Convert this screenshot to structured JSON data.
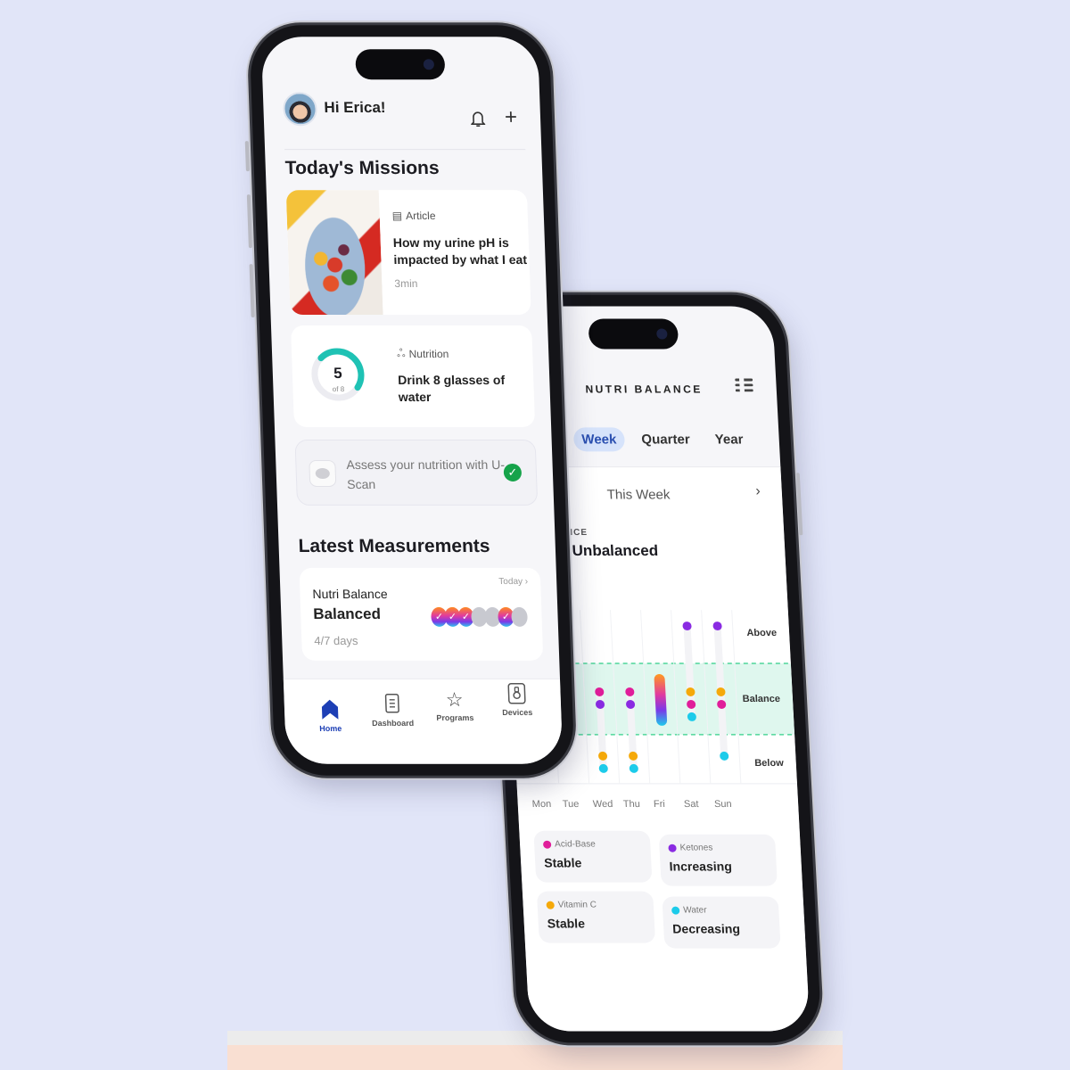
{
  "colors": {
    "background": "#e1e5f8",
    "accent_blue": "#1d3fb5",
    "gauge_teal": "#1fc2b4",
    "success_green": "#16a34a",
    "balance_band": "#dff7ee",
    "acid_base": "#e01e9a",
    "ketones": "#8a2be2",
    "vitamin_c": "#f5a90a",
    "water": "#1ccbea"
  },
  "home_screen": {
    "greeting": "Hi Erica!",
    "header_icons": [
      "bell-icon",
      "plus-icon"
    ],
    "missions_title": "Today's Missions",
    "article_card": {
      "tag": "Article",
      "title": "How my urine pH is impacted by what I eat",
      "duration": "3min"
    },
    "nutrition_card": {
      "tag": "Nutrition",
      "title": "Drink 8 glasses of water",
      "progress_value": "5",
      "progress_total_label": "of 8",
      "progress_current": 5,
      "progress_total": 8
    },
    "uscan_card": {
      "text": "Assess your nutrition with U-Scan",
      "completed": true
    },
    "measurements_title": "Latest Measurements",
    "measurement_card": {
      "name": "Nutri Balance",
      "status": "Balanced",
      "days": "4/7 days",
      "date_link": "Today",
      "week_results": [
        true,
        true,
        true,
        false,
        false,
        true,
        false
      ]
    },
    "tabbar": [
      {
        "label": "Home",
        "icon": "home-icon",
        "active": true
      },
      {
        "label": "Dashboard",
        "icon": "dashboard-icon",
        "active": false
      },
      {
        "label": "Programs",
        "icon": "star-icon",
        "active": false
      },
      {
        "label": "Devices",
        "icon": "device-icon",
        "active": false
      }
    ]
  },
  "balance_screen": {
    "title": "NUTRI BALANCE",
    "period_tabs": [
      {
        "label": "Week",
        "active": true
      },
      {
        "label": "Quarter",
        "active": false
      },
      {
        "label": "Year",
        "active": false
      }
    ],
    "period_label": "This Week",
    "metric_caption": "NCE",
    "metric_value": "ys Unbalanced",
    "chart_levels": [
      "Above",
      "Balance",
      "Below"
    ],
    "days": [
      "Mon",
      "Tue",
      "Wed",
      "Thu",
      "Fri",
      "Sat",
      "Sun"
    ],
    "day_markers": [
      {
        "day": "Mon",
        "points": []
      },
      {
        "day": "Tue",
        "points": []
      },
      {
        "day": "Wed",
        "points": [
          {
            "k": "acid_base",
            "lvl": "Balance"
          },
          {
            "k": "ketones",
            "lvl": "Balance"
          },
          {
            "k": "vitamin_c",
            "lvl": "Below"
          },
          {
            "k": "water",
            "lvl": "Below"
          }
        ]
      },
      {
        "day": "Thu",
        "points": [
          {
            "k": "acid_base",
            "lvl": "Balance"
          },
          {
            "k": "ketones",
            "lvl": "Balance"
          },
          {
            "k": "vitamin_c",
            "lvl": "Below"
          },
          {
            "k": "water",
            "lvl": "Below"
          }
        ]
      },
      {
        "day": "Fri",
        "points": [
          {
            "k": "all",
            "lvl": "Balance",
            "balanced": true
          }
        ]
      },
      {
        "day": "Sat",
        "points": [
          {
            "k": "ketones",
            "lvl": "Above"
          },
          {
            "k": "vitamin_c",
            "lvl": "Balance"
          },
          {
            "k": "acid_base",
            "lvl": "Balance"
          },
          {
            "k": "water",
            "lvl": "Balance"
          }
        ]
      },
      {
        "day": "Sun",
        "points": [
          {
            "k": "ketones",
            "lvl": "Above"
          },
          {
            "k": "vitamin_c",
            "lvl": "Balance"
          },
          {
            "k": "acid_base",
            "lvl": "Balance"
          },
          {
            "k": "water",
            "lvl": "Below"
          }
        ]
      }
    ],
    "stats": [
      {
        "name": "Acid-Base",
        "value": "Stable",
        "color_key": "acid_base"
      },
      {
        "name": "Ketones",
        "value": "Increasing",
        "color_key": "ketones"
      },
      {
        "name": "Vitamin C",
        "value": "Stable",
        "color_key": "vitamin_c"
      },
      {
        "name": "Water",
        "value": "Decreasing",
        "color_key": "water"
      }
    ]
  }
}
